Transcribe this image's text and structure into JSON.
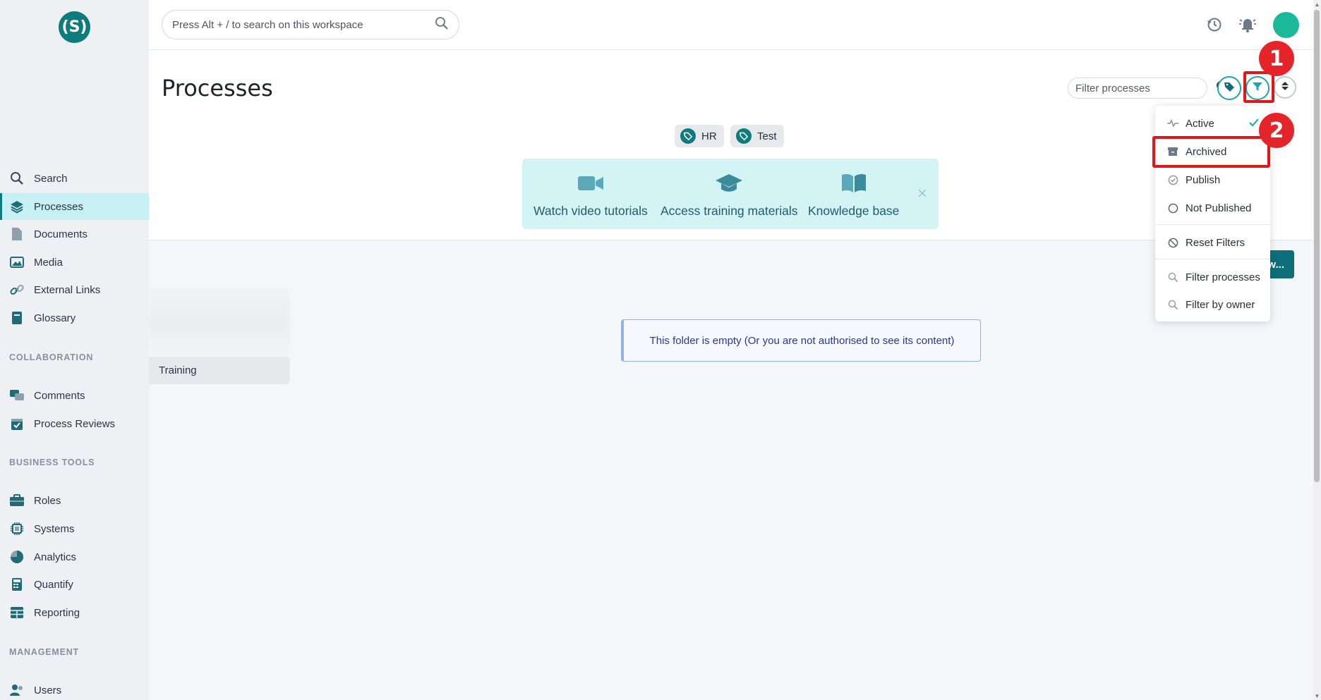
{
  "app": {
    "logo_text": "(S)"
  },
  "sidebar": {
    "items": [
      {
        "label": "Search",
        "icon": "search-icon"
      },
      {
        "label": "Processes",
        "icon": "layers-icon",
        "active": true
      },
      {
        "label": "Documents",
        "icon": "document-icon"
      },
      {
        "label": "Media",
        "icon": "image-icon"
      },
      {
        "label": "External Links",
        "icon": "link-icon"
      },
      {
        "label": "Glossary",
        "icon": "book-icon"
      }
    ],
    "sections": {
      "collaboration": "COLLABORATION",
      "business_tools": "BUSINESS TOOLS",
      "management": "MANAGEMENT"
    },
    "collaboration_items": [
      {
        "label": "Comments",
        "icon": "comments-icon"
      },
      {
        "label": "Process Reviews",
        "icon": "calendar-check-icon"
      }
    ],
    "business_items": [
      {
        "label": "Roles",
        "icon": "briefcase-icon"
      },
      {
        "label": "Systems",
        "icon": "chip-icon"
      },
      {
        "label": "Analytics",
        "icon": "pie-chart-icon"
      },
      {
        "label": "Quantify",
        "icon": "calculator-icon"
      },
      {
        "label": "Reporting",
        "icon": "table-icon"
      }
    ],
    "management_items": [
      {
        "label": "Users",
        "icon": "users-icon"
      }
    ]
  },
  "topbar": {
    "search_placeholder": "Press Alt + / to search on this workspace"
  },
  "page": {
    "title": "Processes",
    "filter_placeholder": "Filter processes",
    "tags": [
      "HR",
      "Test"
    ]
  },
  "promo": {
    "items": [
      {
        "label": "Watch video tutorials",
        "icon": "video-camera-icon"
      },
      {
        "label": "Access training materials",
        "icon": "graduation-cap-icon"
      },
      {
        "label": "Knowledge base",
        "icon": "open-book-icon"
      }
    ],
    "close": "×"
  },
  "content": {
    "folder_item": "Training",
    "empty_message": "This folder is empty (Or you are not authorised to see its content)",
    "new_button_label": "w..."
  },
  "dropdown": {
    "items": [
      {
        "label": "Active",
        "icon": "pulse-icon",
        "checked": true
      },
      {
        "label": "Archived",
        "icon": "archive-icon"
      },
      {
        "label": "Publish",
        "icon": "check-circle-icon"
      },
      {
        "label": "Not Published",
        "icon": "circle-icon"
      },
      {
        "label": "Reset Filters",
        "icon": "ban-icon"
      },
      {
        "label": "Filter processes",
        "icon": "search-icon"
      },
      {
        "label": "Filter by owner",
        "icon": "search-icon"
      }
    ]
  },
  "annotations": {
    "step1": "1",
    "step2": "2",
    "highlight_color": "#e0161b"
  },
  "colors": {
    "brand": "#0e7c7b",
    "accent": "#1aa7b0",
    "active_nav_bg": "#c7f0f4",
    "promo_bg": "#d3f3f5"
  }
}
